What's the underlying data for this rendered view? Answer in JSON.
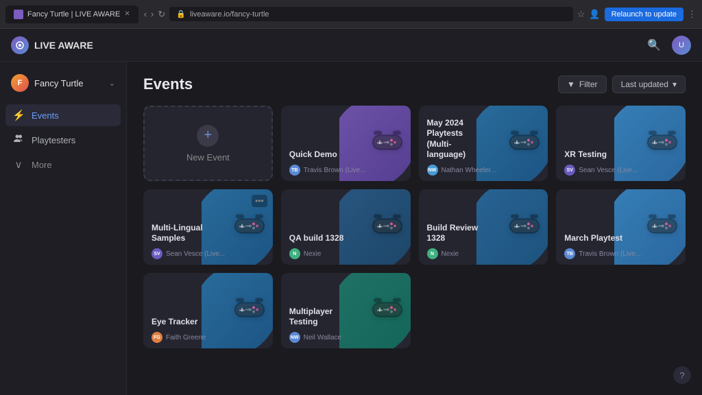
{
  "browser": {
    "tab_title": "Fancy Turtle | LIVE AWARE",
    "url": "liveaware.io/fancy-turtle",
    "relaunch_label": "Relaunch to update"
  },
  "app": {
    "name": "LIVE AWARE",
    "logo_text": "LA"
  },
  "sidebar": {
    "org_name": "Fancy Turtle",
    "items": [
      {
        "id": "events",
        "label": "Events",
        "icon": "⚡",
        "active": true
      },
      {
        "id": "playtesters",
        "label": "Playtesters",
        "icon": "👥",
        "active": false
      },
      {
        "id": "more",
        "label": "More",
        "icon": "∨",
        "active": false
      }
    ]
  },
  "page": {
    "title": "Events",
    "filter_label": "Filter",
    "sort_label": "Last updated"
  },
  "events": [
    {
      "id": "new",
      "type": "new",
      "label": "New Event"
    },
    {
      "id": "quick-demo",
      "type": "event",
      "title": "Quick Demo",
      "user": "Travis Brown (Live...",
      "color1": "#7c5cbf",
      "color2": "#5b40a0",
      "avatar_color": "#5b8ad4",
      "avatar_initials": "TB"
    },
    {
      "id": "may-2024",
      "type": "event",
      "title": "May 2024 Playtests (Multi-language)",
      "user": "Nathan Wheeler...",
      "color1": "#2a7ab0",
      "color2": "#1a5a90",
      "avatar_color": "#4a9ad4",
      "avatar_initials": "NW"
    },
    {
      "id": "xr-testing",
      "type": "event",
      "title": "XR Testing",
      "user": "Sean Vesce (Live...",
      "color1": "#3a90d0",
      "color2": "#2a70b0",
      "avatar_color": "#6a5cbf",
      "avatar_initials": "SV"
    },
    {
      "id": "multi-lingual",
      "type": "event",
      "title": "Multi-Lingual Samples",
      "user": "Sean Vesce (Live...",
      "color1": "#2a7ab0",
      "color2": "#1a5a90",
      "avatar_color": "#6a5cbf",
      "avatar_initials": "SV",
      "has_menu": true
    },
    {
      "id": "qa-build",
      "type": "event",
      "title": "QA build 1328",
      "user": "Nexie",
      "color1": "#2a6090",
      "color2": "#1a4a70",
      "avatar_color": "#40b080",
      "avatar_initials": "N"
    },
    {
      "id": "build-review",
      "type": "event",
      "title": "Build Review 1328",
      "user": "Nexie",
      "color1": "#2a70a8",
      "color2": "#1a5888",
      "avatar_color": "#40b080",
      "avatar_initials": "N"
    },
    {
      "id": "march-playtest",
      "type": "event",
      "title": "March Playtest",
      "user": "Travis Brown (Live...",
      "color1": "#3a90d0",
      "color2": "#2a70b0",
      "avatar_color": "#5b8ad4",
      "avatar_initials": "TB"
    },
    {
      "id": "eye-tracker",
      "type": "event",
      "title": "Eye Tracker",
      "user": "Faith Greene",
      "color1": "#2a7ab0",
      "color2": "#1a5a90",
      "avatar_color": "#e08040",
      "avatar_initials": "FG"
    },
    {
      "id": "multiplayer",
      "type": "event",
      "title": "Multiplayer Testing",
      "user": "Neil Wallace",
      "color1": "#208070",
      "color2": "#107060",
      "avatar_color": "#5b8ad4",
      "avatar_initials": "NW"
    }
  ],
  "help": {
    "icon": "?"
  }
}
